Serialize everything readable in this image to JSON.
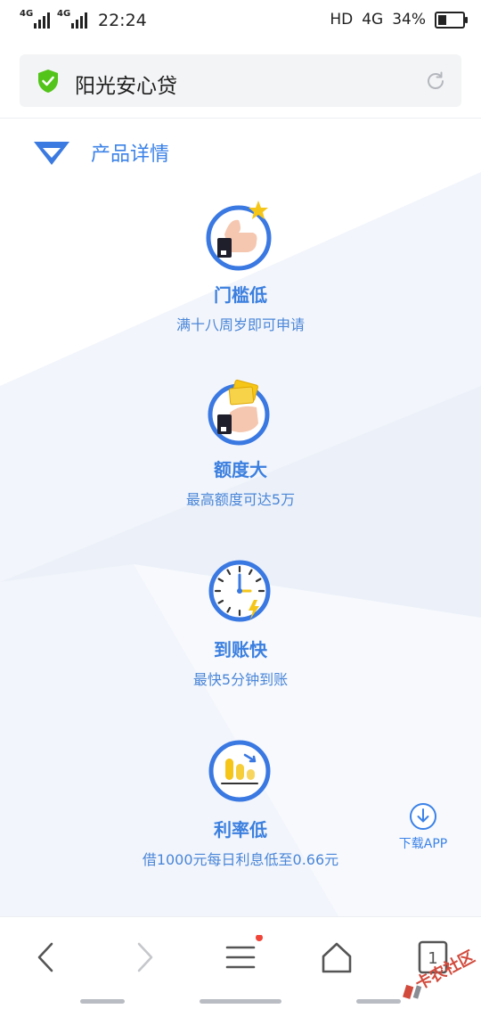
{
  "status_bar": {
    "signal1_label": "4G",
    "signal2_label": "4G",
    "time": "22:24",
    "hd_label": "HD",
    "network_label": "4G",
    "battery_text": "34%",
    "battery_level": 0.34
  },
  "browser": {
    "page_title": "阳光安心贷",
    "shield_icon": "shield-check-icon",
    "reload_icon": "reload-icon"
  },
  "section": {
    "title": "产品详情",
    "icon": "diamond-icon"
  },
  "features": [
    {
      "icon": "thumbs-up-icon",
      "title": "门槛低",
      "desc": "满十八周岁即可申请"
    },
    {
      "icon": "money-hand-icon",
      "title": "额度大",
      "desc": "最高额度可达5万"
    },
    {
      "icon": "clock-icon",
      "title": "到账快",
      "desc": "最快5分钟到账"
    },
    {
      "icon": "rate-icon",
      "title": "利率低",
      "desc": "借1000元每日利息低至0.66元"
    }
  ],
  "download": {
    "label": "下载APP",
    "icon": "download-icon"
  },
  "bottom_nav": {
    "tab_count": "1",
    "items": [
      "back-icon",
      "forward-icon",
      "menu-icon",
      "home-icon",
      "tabs-icon"
    ]
  },
  "watermark": {
    "text": "卡农社区"
  },
  "colors": {
    "accent": "#3b82e8",
    "shield": "#52c41a",
    "gold": "#f5c518"
  }
}
